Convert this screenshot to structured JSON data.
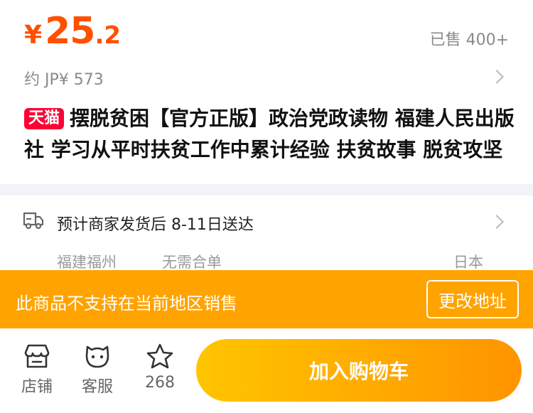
{
  "price": {
    "currency": "¥",
    "integer": "25",
    "decimal": ".2"
  },
  "sold": "已售 400+",
  "approx_price": "约 JP¥ 573",
  "product": {
    "badge": "天猫",
    "title": "摆脱贫困【官方正版】政治党政读物 福建人民出版社 学习从平时扶贫工作中累计经验 扶贫故事 脱贫攻坚"
  },
  "shipping": {
    "text": "预计商家发货后 8-11日送达",
    "origin": "福建福州",
    "merge": "无需合单",
    "destination": "日本"
  },
  "notice": {
    "text": "此商品不支持在当前地区销售",
    "button": "更改地址"
  },
  "bottom_bar": {
    "store": "店铺",
    "service": "客服",
    "favorites": "268",
    "add_to_cart": "加入购物车"
  },
  "colors": {
    "price": "#ff5000",
    "tmall_badge": "#ff0036",
    "notice_bg": "#ffa300",
    "cart_gradient_start": "#ffc500",
    "cart_gradient_end": "#ff9400"
  }
}
